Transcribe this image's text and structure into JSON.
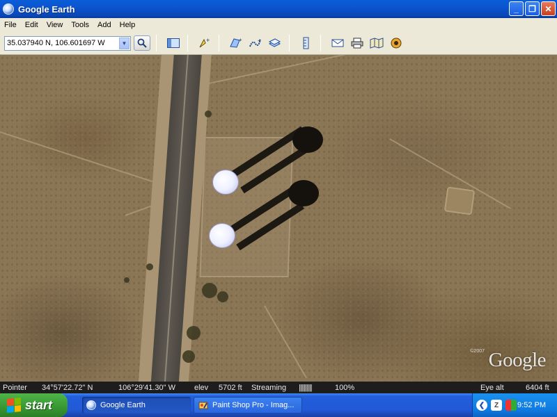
{
  "window": {
    "title": "Google Earth",
    "controls": {
      "minimize": "_",
      "maximize": "❐",
      "close": "✕"
    }
  },
  "menu": [
    "File",
    "Edit",
    "View",
    "Tools",
    "Add",
    "Help"
  ],
  "toolbar": {
    "coordinates": "35.037940 N, 106.601697 W",
    "icons": [
      "search-icon",
      "sidebar-icon",
      "placemark-icon",
      "polygon-icon",
      "path-icon",
      "overlay-icon",
      "ruler-icon",
      "email-icon",
      "print-icon",
      "maps-icon",
      "sky-icon"
    ]
  },
  "map": {
    "watermark": "Google",
    "copyright": "©2007"
  },
  "status": {
    "pointer_label": "Pointer",
    "lat": "34°57'22.72\" N",
    "lon": "106°29'41.30\" W",
    "elev_label": "elev",
    "elev": "5702 ft",
    "streaming_label": "Streaming",
    "streaming_bar": "||||||||||",
    "streaming_pct": "100%",
    "eye_alt_label": "Eye alt",
    "eye_alt": "6404 ft"
  },
  "taskbar": {
    "start_label": "start",
    "items": [
      {
        "label": "Google Earth",
        "active": true
      },
      {
        "label": "Paint Shop Pro - Imag...",
        "active": false
      }
    ],
    "clock": "9:52 PM"
  }
}
